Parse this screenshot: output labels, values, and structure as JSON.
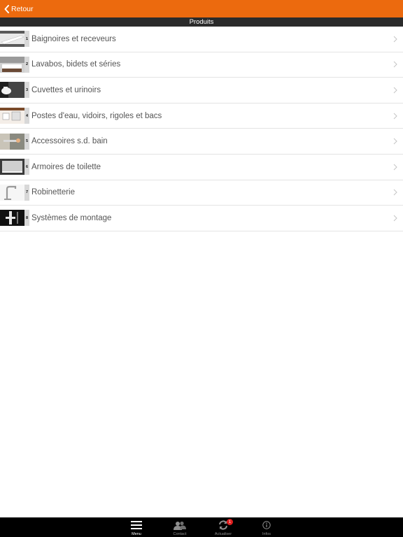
{
  "header": {
    "back_label": "Retour"
  },
  "section": {
    "title": "Produits"
  },
  "products": [
    {
      "number": "1",
      "label": "Baignoires et receveurs",
      "thumb": "bathtub"
    },
    {
      "number": "2",
      "label": "Lavabos, bidets et séries",
      "thumb": "washbasin"
    },
    {
      "number": "3",
      "label": "Cuvettes et urinoirs",
      "thumb": "toilet"
    },
    {
      "number": "4",
      "label": "Postes d'eau, vidoirs, rigoles et bacs",
      "thumb": "utility-sink"
    },
    {
      "number": "5",
      "label": "Accessoires s.d. bain",
      "thumb": "accessories"
    },
    {
      "number": "6",
      "label": "Armoires de toilette",
      "thumb": "mirror-cabinet"
    },
    {
      "number": "7",
      "label": "Robinetterie",
      "thumb": "faucet"
    },
    {
      "number": "8",
      "label": "Systèmes de montage",
      "thumb": "mounting-system"
    }
  ],
  "tabbar": {
    "tabs": [
      {
        "label": "Menu",
        "icon": "menu-icon",
        "active": true
      },
      {
        "label": "Contact",
        "icon": "contact-icon",
        "active": false
      },
      {
        "label": "Actualiser",
        "icon": "refresh-icon",
        "active": false,
        "badge": "1"
      },
      {
        "label": "Infos",
        "icon": "info-icon",
        "active": false
      }
    ]
  },
  "colors": {
    "accent": "#ec6a0e",
    "section_bar": "#2b2b2b",
    "tabbar": "#000000",
    "badge": "#e02020"
  }
}
